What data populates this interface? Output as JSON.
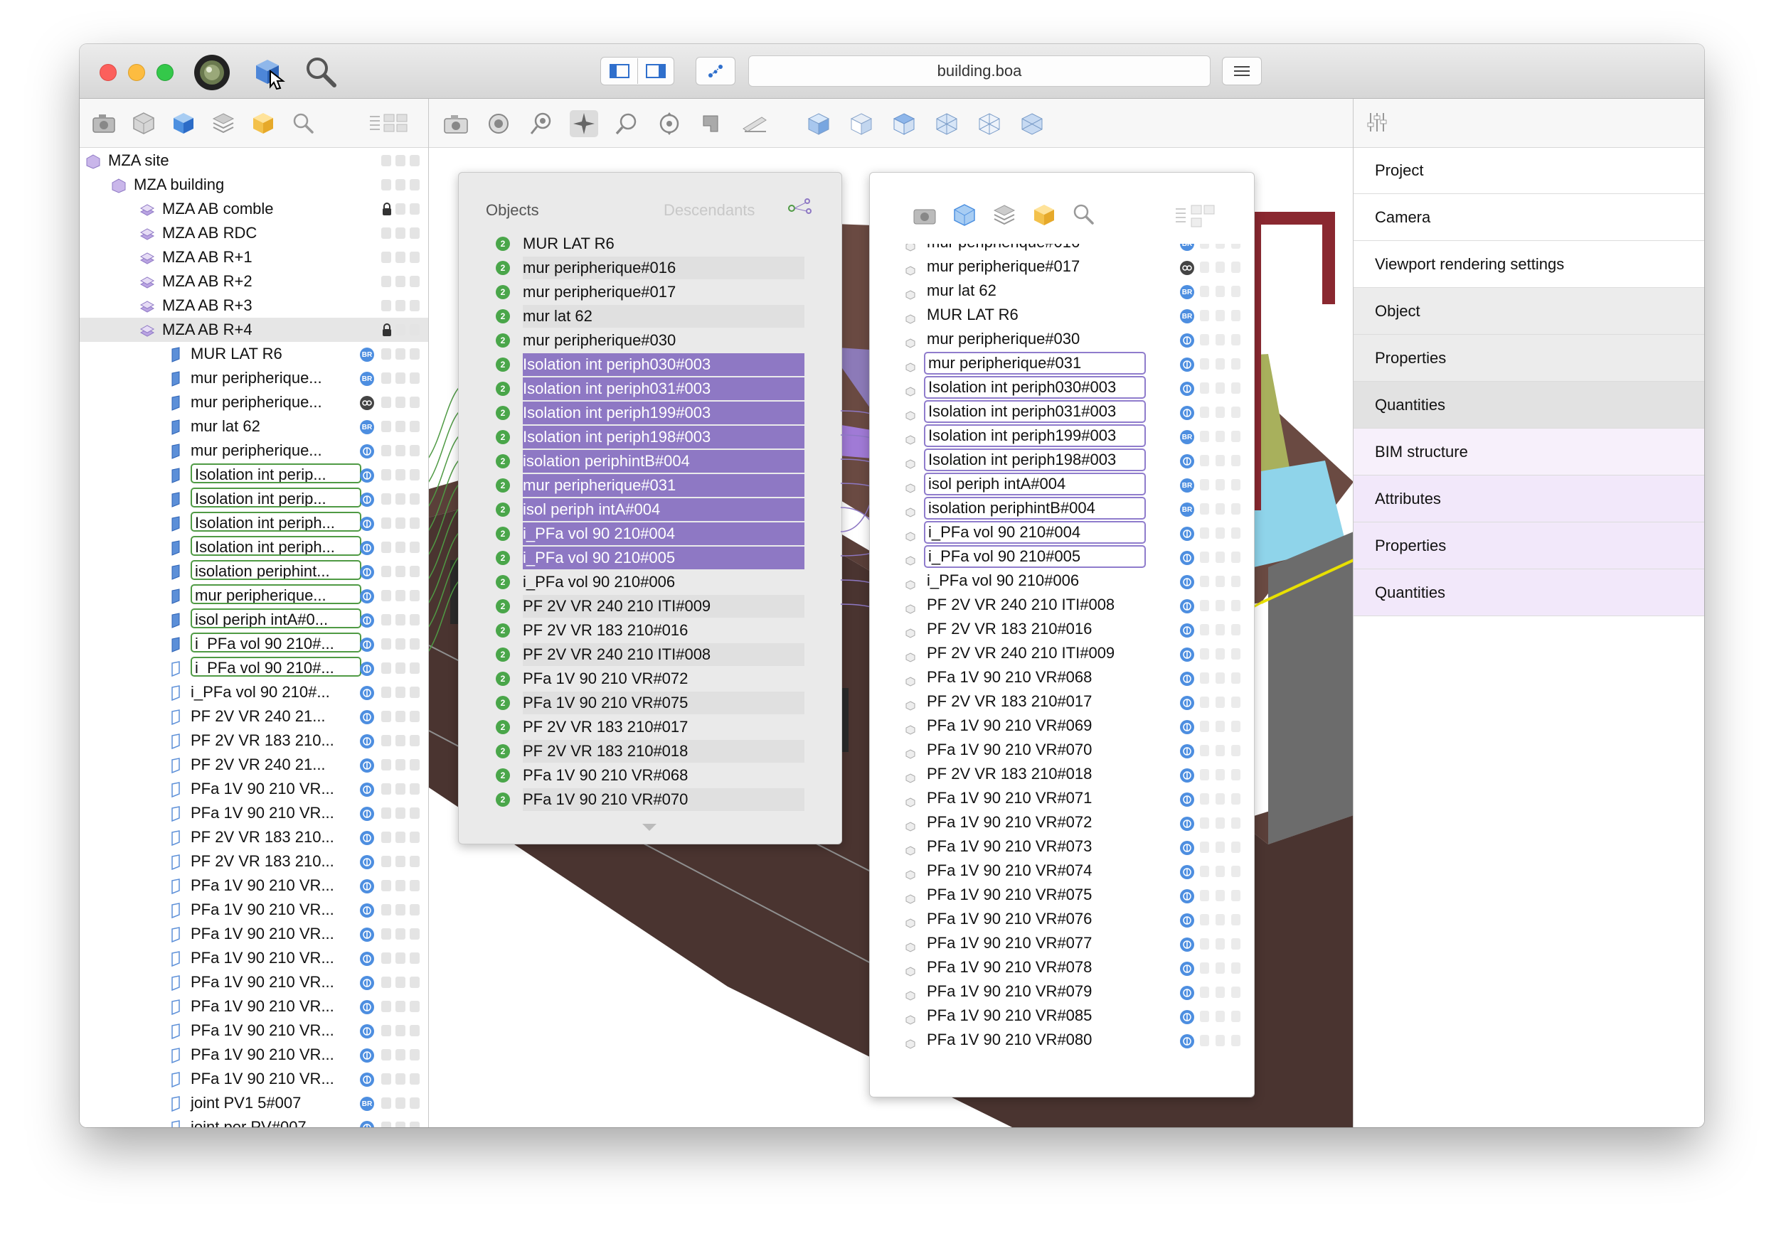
{
  "window": {
    "title": "building.boa"
  },
  "left_tree": {
    "rows": [
      {
        "label": "MZA site",
        "badge": ""
      },
      {
        "label": "MZA building",
        "badge": ""
      },
      {
        "label": "MZA AB comble",
        "badge": "lock"
      },
      {
        "label": "MZA AB RDC",
        "badge": ""
      },
      {
        "label": "MZA AB R+1",
        "badge": ""
      },
      {
        "label": "MZA AB R+2",
        "badge": ""
      },
      {
        "label": "MZA AB R+3",
        "badge": ""
      },
      {
        "label": "MZA AB R+4",
        "badge": "lock"
      },
      {
        "label": "MUR LAT R6",
        "badge": "BR"
      },
      {
        "label": "mur peripherique...",
        "badge": "BR"
      },
      {
        "label": "mur peripherique...",
        "badge": "OO"
      },
      {
        "label": "mur lat 62",
        "badge": "BR"
      },
      {
        "label": "mur peripherique...",
        "badge": "CB"
      },
      {
        "label": "Isolation int perip...",
        "badge": "CB"
      },
      {
        "label": "Isolation int perip...",
        "badge": "CB"
      },
      {
        "label": "Isolation int periph...",
        "badge": "CB"
      },
      {
        "label": "Isolation int periph...",
        "badge": "CB"
      },
      {
        "label": "isolation periphint...",
        "badge": "CB"
      },
      {
        "label": "mur peripherique...",
        "badge": "CB"
      },
      {
        "label": "isol periph intA#0...",
        "badge": "CB"
      },
      {
        "label": "i_PFa vol 90 210#...",
        "badge": "CB"
      },
      {
        "label": "i_PFa vol 90 210#...",
        "badge": "CB"
      },
      {
        "label": "i_PFa vol 90 210#...",
        "badge": "CB"
      },
      {
        "label": "PF 2V VR  240 21...",
        "badge": "CB"
      },
      {
        "label": "PF 2V VR 183 210...",
        "badge": "CB"
      },
      {
        "label": "PF 2V VR  240 21...",
        "badge": "CB"
      },
      {
        "label": "PFa 1V 90 210 VR...",
        "badge": "CB"
      },
      {
        "label": "PFa 1V 90 210 VR...",
        "badge": "CB"
      },
      {
        "label": "PF 2V VR 183 210...",
        "badge": "CB"
      },
      {
        "label": "PF 2V VR 183 210...",
        "badge": "CB"
      },
      {
        "label": "PFa 1V 90 210 VR...",
        "badge": "CB"
      },
      {
        "label": "PFa 1V 90 210 VR...",
        "badge": "CB"
      },
      {
        "label": "PFa 1V 90 210 VR...",
        "badge": "CB"
      },
      {
        "label": "PFa 1V 90 210 VR...",
        "badge": "CB"
      },
      {
        "label": "PFa 1V 90 210 VR...",
        "badge": "CB"
      },
      {
        "label": "PFa 1V 90 210 VR...",
        "badge": "CB"
      },
      {
        "label": "PFa 1V 90 210 VR...",
        "badge": "CB"
      },
      {
        "label": "PFa 1V 90 210 VR...",
        "badge": "CB"
      },
      {
        "label": "PFa 1V 90 210 VR...",
        "badge": "CB"
      },
      {
        "label": "joint PV1 5#007",
        "badge": "BR"
      },
      {
        "label": "joint per PV#007",
        "badge": "CB"
      }
    ]
  },
  "objects_popover": {
    "title": "Objects",
    "tab2": "Descendants",
    "badge_number": "2",
    "rows": [
      "MUR LAT R6",
      "mur peripherique#016",
      "mur peripherique#017",
      "mur lat 62",
      "mur peripherique#030",
      "Isolation int periph030#003",
      "Isolation int periph031#003",
      "Isolation int periph199#003",
      "Isolation int periph198#003",
      "isolation periphintB#004",
      "mur peripherique#031",
      "isol periph intA#004",
      "i_PFa vol 90 210#004",
      "i_PFa vol 90 210#005",
      "i_PFa vol 90 210#006",
      "PF 2V VR  240 210 ITI#009",
      "PF 2V VR 183 210#016",
      "PF 2V VR  240 210 ITI#008",
      "PFa 1V 90 210 VR#072",
      "PFa 1V 90 210 VR#075",
      "PF 2V VR 183 210#017",
      "PF 2V VR 183 210#018",
      "PFa 1V 90 210 VR#068",
      "PFa 1V 90 210 VR#070"
    ]
  },
  "second_popover": {
    "rows": [
      {
        "label": "mur peripherique#016",
        "badge": "BR"
      },
      {
        "label": "mur peripherique#017",
        "badge": "OO"
      },
      {
        "label": "mur lat 62",
        "badge": "BR"
      },
      {
        "label": "MUR LAT R6",
        "badge": "BR"
      },
      {
        "label": "mur peripherique#030",
        "badge": "CB"
      },
      {
        "label": "mur peripherique#031",
        "badge": "CB"
      },
      {
        "label": "Isolation int periph030#003",
        "badge": "CB"
      },
      {
        "label": "Isolation int periph031#003",
        "badge": "CB"
      },
      {
        "label": "Isolation int periph199#003",
        "badge": "BR"
      },
      {
        "label": "Isolation int periph198#003",
        "badge": "CB"
      },
      {
        "label": "isol periph intA#004",
        "badge": "BR"
      },
      {
        "label": "isolation periphintB#004",
        "badge": "BR"
      },
      {
        "label": "i_PFa vol 90 210#004",
        "badge": "CB"
      },
      {
        "label": "i_PFa vol 90 210#005",
        "badge": "CB"
      },
      {
        "label": "i_PFa vol 90 210#006",
        "badge": "CB"
      },
      {
        "label": "PF 2V VR  240 210 ITI#008",
        "badge": "CB"
      },
      {
        "label": "PF 2V VR 183 210#016",
        "badge": "CB"
      },
      {
        "label": "PF 2V VR  240 210 ITI#009",
        "badge": "CB"
      },
      {
        "label": "PFa 1V 90 210 VR#068",
        "badge": "CB"
      },
      {
        "label": "PF 2V VR 183 210#017",
        "badge": "CB"
      },
      {
        "label": "PFa 1V 90 210 VR#069",
        "badge": "CB"
      },
      {
        "label": "PFa 1V 90 210 VR#070",
        "badge": "CB"
      },
      {
        "label": "PF 2V VR 183 210#018",
        "badge": "CB"
      },
      {
        "label": "PFa 1V 90 210 VR#071",
        "badge": "CB"
      },
      {
        "label": "PFa 1V 90 210 VR#072",
        "badge": "CB"
      },
      {
        "label": "PFa 1V 90 210 VR#073",
        "badge": "CB"
      },
      {
        "label": "PFa 1V 90 210 VR#074",
        "badge": "CB"
      },
      {
        "label": "PFa 1V 90 210 VR#075",
        "badge": "CB"
      },
      {
        "label": "PFa 1V 90 210 VR#076",
        "badge": "CB"
      },
      {
        "label": "PFa 1V 90 210 VR#077",
        "badge": "CB"
      },
      {
        "label": "PFa 1V 90 210 VR#078",
        "badge": "CB"
      },
      {
        "label": "PFa 1V 90 210 VR#079",
        "badge": "CB"
      },
      {
        "label": "PFa 1V 90 210 VR#085",
        "badge": "CB"
      },
      {
        "label": "PFa 1V 90 210 VR#080",
        "badge": "CB"
      }
    ]
  },
  "inspector": {
    "items": [
      "Project",
      "Camera",
      "Viewport rendering settings",
      "Object",
      "Properties",
      "Quantities",
      "BIM structure",
      "Attributes",
      "Properties",
      "Quantities"
    ]
  },
  "colors": {
    "accent_purple": "#8e78c4",
    "link_green": "#4f9a44",
    "badge_blue": "#4d8ee0",
    "selected_section": "#e8e8e8",
    "bim_section": "#f5ecfb"
  }
}
